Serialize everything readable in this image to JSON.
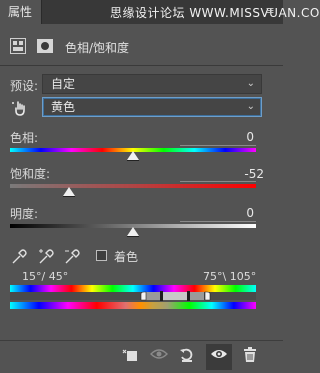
{
  "panel": {
    "tab_label": "属性",
    "watermark": "思缘设计论坛 WWW.MISSVUAN.COM",
    "menu_icon": "panel-menu-icon"
  },
  "header": {
    "title": "色相/饱和度",
    "icons": [
      "adjustment-layer-icon",
      "mask-icon"
    ]
  },
  "preset": {
    "label": "预设:",
    "value": "自定"
  },
  "channel": {
    "value": "黄色",
    "icon": "targeted-adjustment-hand-icon"
  },
  "hue": {
    "label": "色相:",
    "value": "0",
    "level": 0.5
  },
  "saturation": {
    "label": "饱和度:",
    "value": "-52",
    "level": 0.24
  },
  "lightness": {
    "label": "明度:",
    "value": "0",
    "level": 0.5
  },
  "tools": {
    "eyedroppers": [
      "eyedropper-icon",
      "eyedropper-plus-icon",
      "eyedropper-minus-icon"
    ],
    "colorize_label": "着色",
    "colorize_checked": false
  },
  "range": {
    "left_text": "15°/ 45°",
    "right_text": "75°\\ 105°"
  },
  "bottom_toolbar": [
    "clip-to-layer-icon",
    "view-previous-state-icon",
    "reset-icon",
    "visibility-eye-icon",
    "trash-icon"
  ],
  "colors": {
    "panel_bg": "#535353",
    "tab_bar_bg": "#383838",
    "active_field_border": "#6e9ec9"
  }
}
